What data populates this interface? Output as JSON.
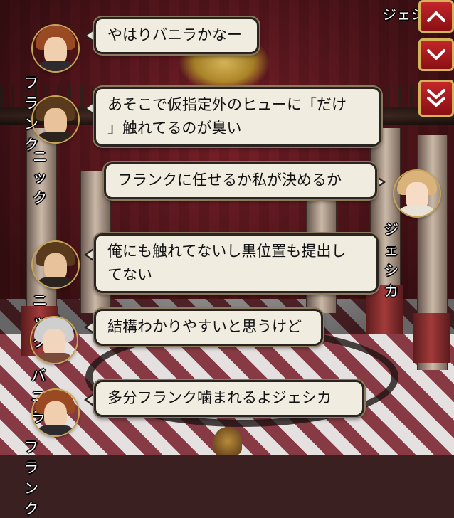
{
  "messages": [
    {
      "speaker": "フランク",
      "text": "やはりバニラかなー",
      "avatar": "frank-avatar",
      "side": "left"
    },
    {
      "speaker": "ニック",
      "text": "あそこで仮指定外のヒューに「だけ」触れてるのが臭い",
      "line1": "あそこで仮指定外のヒューに「だけ",
      "line2": "」触れてるのが臭い",
      "avatar": "nick-avatar",
      "side": "left"
    },
    {
      "speaker": "ジェシカ",
      "text": "フランクに任せるか私が決めるか",
      "avatar": "jessica-avatar",
      "side": "right"
    },
    {
      "speaker": "ニック",
      "text": "俺にも触れてないし黒位置も提出してない",
      "line1": "俺にも触れてないし黒位置も提出し",
      "line2": "てない",
      "avatar": "nick-avatar",
      "side": "left"
    },
    {
      "speaker": "バニラ",
      "text": "結構わかりやすいと思うけど",
      "avatar": "vanilla-avatar",
      "side": "left"
    },
    {
      "speaker": "フランク",
      "text": "多分フランク噛まれるよジェシカ",
      "avatar": "frank-avatar",
      "side": "left"
    }
  ],
  "top_partial_name": "ジェシ",
  "nav_buttons": [
    {
      "icon": "chevron-up-icon"
    },
    {
      "icon": "chevron-down-icon"
    },
    {
      "icon": "double-chevron-down-icon"
    }
  ],
  "colors": {
    "bubble_bg": "#f1ece0",
    "bubble_border": "#2a2420",
    "nav_red": "#c3262a",
    "nav_gold": "#d4b35a",
    "wall_red": "#7a2029"
  }
}
